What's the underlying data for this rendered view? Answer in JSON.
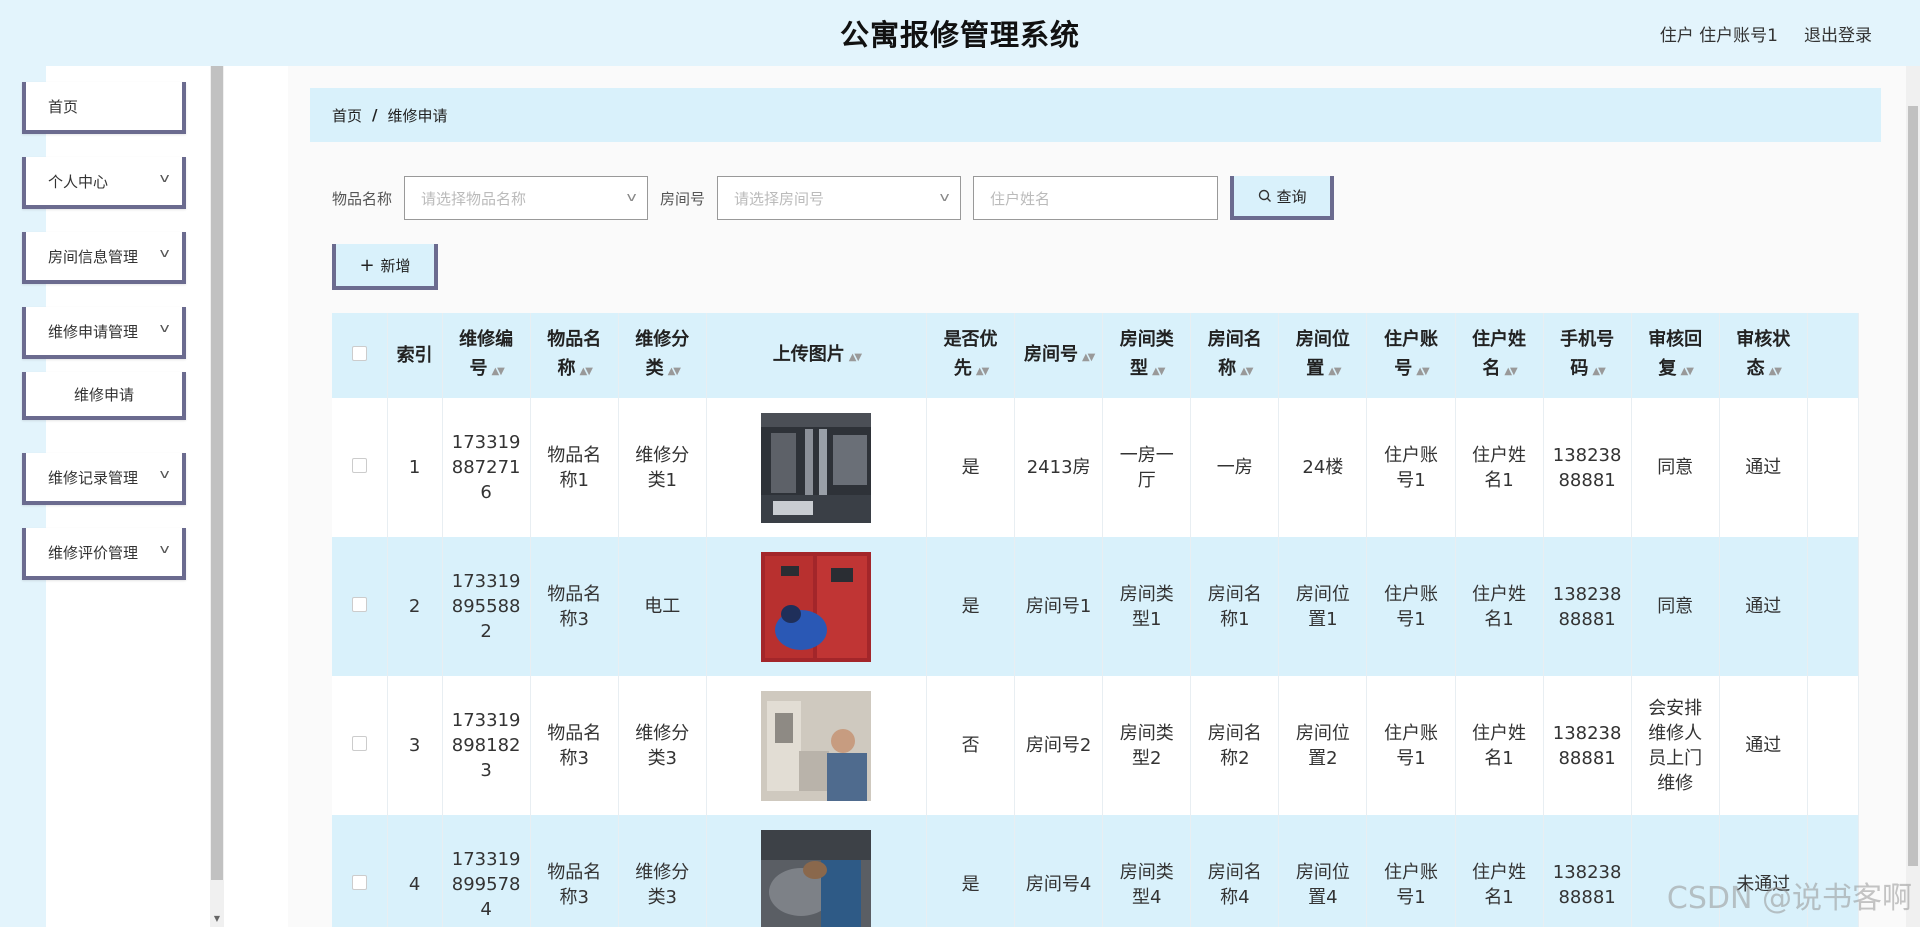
{
  "header": {
    "title": "公寓报修管理系统",
    "user": "住户 住户账号1",
    "logout": "退出登录"
  },
  "sidebar": {
    "items": [
      {
        "label": "首页"
      },
      {
        "label": "个人中心"
      },
      {
        "label": "房间信息管理"
      },
      {
        "label": "维修申请管理"
      },
      {
        "label": "维修申请"
      },
      {
        "label": "维修记录管理"
      },
      {
        "label": "维修评价管理"
      }
    ]
  },
  "breadcrumb": {
    "home": "首页",
    "separator": "/",
    "current": "维修申请"
  },
  "search": {
    "item_label": "物品名称",
    "item_placeholder": "请选择物品名称",
    "room_label": "房间号",
    "room_placeholder": "请选择房间号",
    "name_placeholder": "住户姓名",
    "query_label": "查询"
  },
  "toolbar": {
    "add_label": "新增"
  },
  "table": {
    "headers": {
      "index": "索引",
      "repair_no": "维修编号",
      "item_name": "物品名称",
      "repair_type": "维修分类",
      "image": "上传图片",
      "priority": "是否优先",
      "room_no": "房间号",
      "room_type": "房间类型",
      "room_name": "房间名称",
      "room_location": "房间位置",
      "account": "住户账号",
      "resident_name": "住户姓名",
      "phone": "手机号码",
      "reply": "审核回复",
      "status": "审核状态"
    },
    "rows": [
      {
        "index": "1",
        "repair_no": "1733198872716",
        "item_name": "物品名称1",
        "repair_type": "维修分类1",
        "priority": "是",
        "room_no": "2413房",
        "room_type": "一房一厅",
        "room_name": "一房",
        "room_location": "24楼",
        "account": "住户账号1",
        "resident_name": "住户姓名1",
        "phone": "13823888881",
        "reply": "同意",
        "status": "通过"
      },
      {
        "index": "2",
        "repair_no": "1733198955882",
        "item_name": "物品名称3",
        "repair_type": "电工",
        "priority": "是",
        "room_no": "房间号1",
        "room_type": "房间类型1",
        "room_name": "房间名称1",
        "room_location": "房间位置1",
        "account": "住户账号1",
        "resident_name": "住户姓名1",
        "phone": "13823888881",
        "reply": "同意",
        "status": "通过"
      },
      {
        "index": "3",
        "repair_no": "1733198981823",
        "item_name": "物品名称3",
        "repair_type": "维修分类3",
        "priority": "否",
        "room_no": "房间号2",
        "room_type": "房间类型2",
        "room_name": "房间名称2",
        "room_location": "房间位置2",
        "account": "住户账号1",
        "resident_name": "住户姓名1",
        "phone": "13823888881",
        "reply": "会安排维修人员上门维修",
        "status": "通过"
      },
      {
        "index": "4",
        "repair_no": "1733198995784",
        "item_name": "物品名称3",
        "repair_type": "维修分类3",
        "priority": "是",
        "room_no": "房间号4",
        "room_type": "房间类型4",
        "room_name": "房间名称4",
        "room_location": "房间位置4",
        "account": "住户账号1",
        "resident_name": "住户姓名1",
        "phone": "13823888881",
        "reply": "",
        "status": "未通过"
      }
    ]
  },
  "watermark": "CSDN @说书客啊",
  "colors": {
    "header_bg": "#e3f4fc",
    "accent_blue": "#d9f1fb",
    "button_border": "#6b6b8f"
  }
}
